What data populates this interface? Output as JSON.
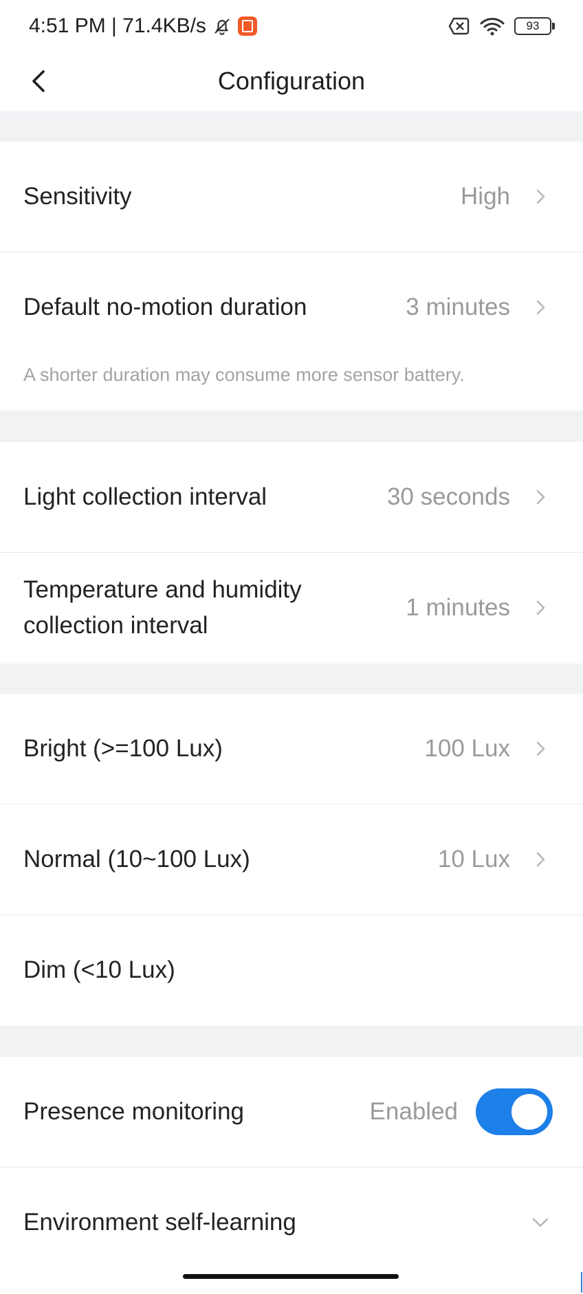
{
  "status_bar": {
    "time_speed": "4:51 PM | 71.4KB/s",
    "battery_level": "93",
    "icons": [
      "dnd-bell-off-icon",
      "app-notification-icon",
      "sim-x-icon",
      "wifi-icon",
      "battery-icon"
    ]
  },
  "header": {
    "title": "Configuration",
    "back_icon": "chevron-left-icon"
  },
  "settings": {
    "sensitivity": {
      "label": "Sensitivity",
      "value": "High"
    },
    "no_motion": {
      "label": "Default no-motion duration",
      "value": "3 minutes",
      "hint": "A shorter duration may consume more sensor battery."
    },
    "light_interval": {
      "label": "Light collection interval",
      "value": "30 seconds"
    },
    "temp_humidity_interval": {
      "label_line1": "Temperature and humidity",
      "label_line2": "collection interval",
      "value": "1 minutes"
    },
    "bright": {
      "label": "Bright (>=100 Lux)",
      "value": "100 Lux"
    },
    "normal": {
      "label": "Normal (10~100 Lux)",
      "value": "10 Lux"
    },
    "dim": {
      "label": "Dim (<10 Lux)"
    },
    "presence": {
      "label": "Presence monitoring",
      "status": "Enabled",
      "toggle_on": true
    },
    "self_learning": {
      "label": "Environment self-learning"
    }
  },
  "colors": {
    "accent": "#1d7fe8",
    "section_gap": "#f1f2f4",
    "secondary_text": "#9a9a9a"
  }
}
